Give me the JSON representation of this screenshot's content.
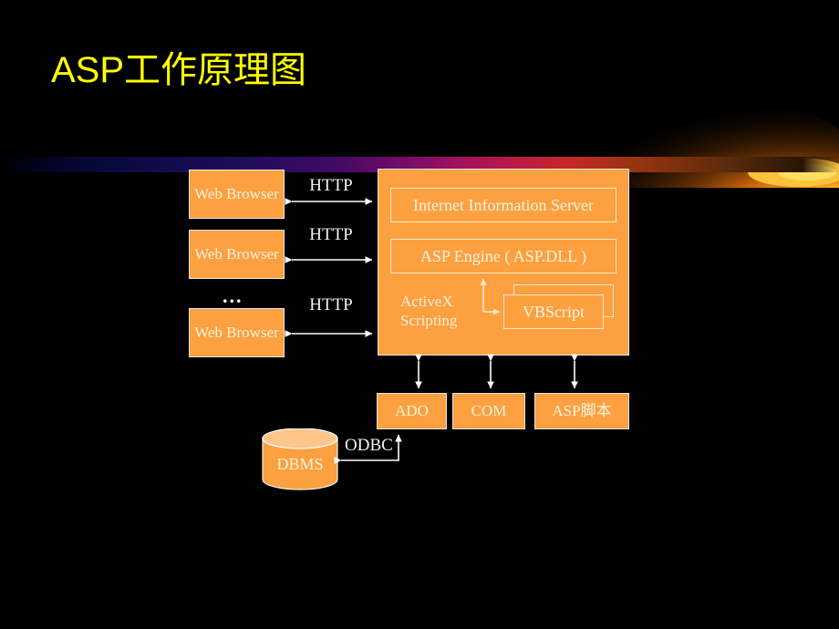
{
  "slide": {
    "title": "ASP工作原理图",
    "title_color": "#FFFF00",
    "background_color": "#000000",
    "accent_box_color": "#FCA040",
    "box_text_color": "#FFF4E0",
    "arrow_color": "#FFFFFF"
  },
  "clients": {
    "browsers": [
      {
        "label": "Web\nBrowser"
      },
      {
        "label": "Web\nBrowser"
      },
      {
        "label": "Web\nBrowser"
      }
    ],
    "ellipsis": "...",
    "links": [
      {
        "label": "HTTP"
      },
      {
        "label": "HTTP"
      },
      {
        "label": "HTTP"
      }
    ]
  },
  "server": {
    "iis_label": "Internet Information Server",
    "asp_engine_label": "ASP Engine ( ASP.DLL )",
    "activex_label": "ActiveX\nScripting",
    "vbscript_label": "VBScript"
  },
  "components": [
    {
      "label": "ADO"
    },
    {
      "label": "COM"
    },
    {
      "label": "ASP脚本"
    }
  ],
  "database": {
    "label": "DBMS",
    "connector_label": "ODBC"
  },
  "icons": {
    "swoosh": "swoosh-glow-decoration",
    "cylinder": "database-cylinder-icon"
  }
}
